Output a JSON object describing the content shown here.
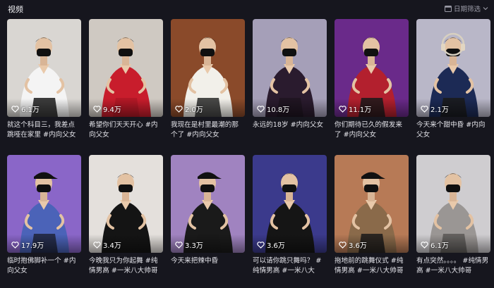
{
  "header": {
    "title": "视频",
    "filter_label": "日期筛选"
  },
  "videos": [
    {
      "likes": "6.1万",
      "caption": "就这个科目三，我差点跳哑在家里 #内向父女",
      "bg": "#d9d6d2",
      "shirt": "#f4f4f4",
      "pants": "#1a1a1a",
      "cap": false,
      "headphones": false
    },
    {
      "likes": "9.4万",
      "caption": "希望你们天天开心 #内向父女",
      "bg": "#cfc9c2",
      "shirt": "#c81d2c",
      "pants": "#b01826",
      "cap": false,
      "headphones": false
    },
    {
      "likes": "2.0万",
      "caption": "我现在是村里最潮的那个了 #内向父女",
      "bg": "#8a4a2a",
      "shirt": "#f2f0ea",
      "pants": "#2a2a2a",
      "cap": false,
      "headphones": false
    },
    {
      "likes": "10.8万",
      "caption": "永远的18岁 #内向父女",
      "bg": "#a59fb8",
      "shirt": "#2a1b2e",
      "pants": "#1e1420",
      "cap": false,
      "headphones": false
    },
    {
      "likes": "11.1万",
      "caption": "你们期待已久的假发来了 #内向父女",
      "bg": "#6a2a8a",
      "shirt": "#b3202e",
      "pants": "#1a1a1a",
      "cap": false,
      "headphones": false
    },
    {
      "likes": "2.1万",
      "caption": "今天来个甜中昏 #内向父女",
      "bg": "#b9b7c8",
      "shirt": "#1c2a55",
      "pants": "#1a1a1a",
      "cap": false,
      "headphones": true
    },
    {
      "likes": "17.9万",
      "caption": "临时抱佛脚补一个 #内向父女",
      "bg": "#8a66c8",
      "shirt": "#4b63b8",
      "pants": "#1e2338",
      "cap": true,
      "headphones": false
    },
    {
      "likes": "3.4万",
      "caption": "今晚我只为你起舞 #纯情男高 #一米八大帅哥",
      "bg": "#e4e0dc",
      "shirt": "#141414",
      "pants": "#141414",
      "cap": false,
      "headphones": false
    },
    {
      "likes": "3.3万",
      "caption": "今天来把辣中昏",
      "bg": "#a083c0",
      "shirt": "#1a1a1a",
      "pants": "#1a1a1a",
      "cap": true,
      "headphones": false
    },
    {
      "likes": "3.6万",
      "caption": "可以请你跳只舞吗？ #纯情男高 #一米八大",
      "bg": "#3b3a8c",
      "shirt": "#151515",
      "pants": "#151515",
      "cap": false,
      "headphones": false
    },
    {
      "likes": "3.6万",
      "caption": "拖地前的跳舞仪式 #纯情男高 #一米八大帅哥",
      "bg": "#b77a56",
      "shirt": "#8a6a4a",
      "pants": "#1a1a1a",
      "cap": true,
      "headphones": false
    },
    {
      "likes": "6.1万",
      "caption": "有点突然。。。。 #纯情男高 #一米八大帅哥",
      "bg": "#cfcdd0",
      "shirt": "#9a9694",
      "pants": "#5a5856",
      "cap": false,
      "headphones": false
    }
  ]
}
